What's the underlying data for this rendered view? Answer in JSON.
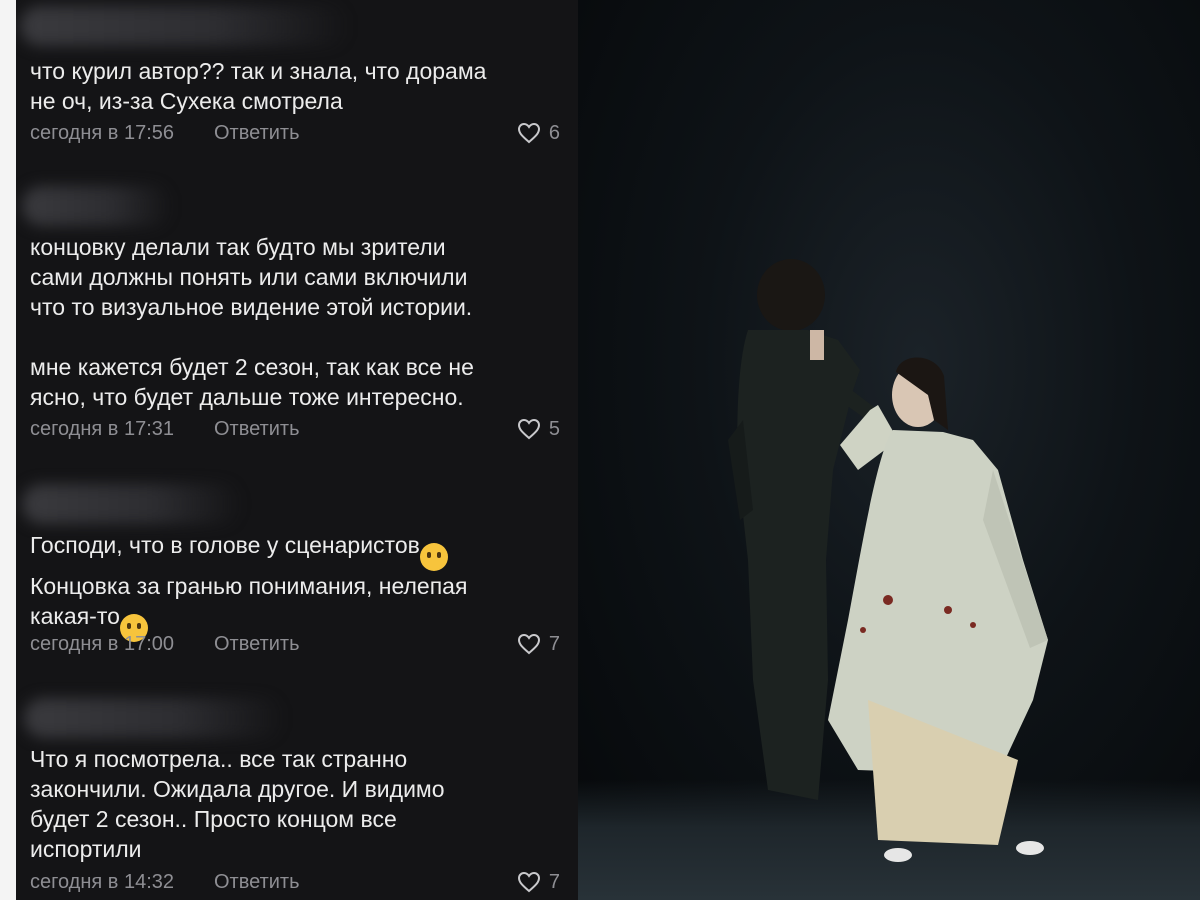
{
  "comments": [
    {
      "text": "что курил автор?? так и знала, что дорама\nне оч, из-за Сухека смотрела",
      "emoji": "",
      "time": "сегодня в 17:56",
      "reply": "Ответить",
      "likes": "6"
    },
    {
      "text": "концовку делали так будто мы зрители\nсами должны понять или сами включили\nчто то визуальное видение этой истории.\n\nмне кажется будет 2 сезон, так как все не\nясно, что будет дальше тоже интересно.",
      "emoji": "",
      "time": "сегодня в 17:31",
      "reply": "Ответить",
      "likes": "5"
    },
    {
      "text_line1": "Господи, что в голове у сценаристов",
      "emoji1": "🤔",
      "text_line2": "Концовка за гранью понимания, нелепая",
      "text_line3": "какая-то",
      "emoji2": "🙄",
      "time": "сегодня в 17:00",
      "reply": "Ответить",
      "likes": "7"
    },
    {
      "text": "Что я посмотрела.. все так странно\nзакончили. Ожидала другое. И видимо\nбудет 2 сезон.. Просто концом все\nиспортили",
      "emoji": "",
      "time": "сегодня в 14:32",
      "reply": "Ответить",
      "likes": "7"
    }
  ],
  "icons": {
    "like": "heart-outline-icon"
  },
  "colors": {
    "panel_bg": "#141416",
    "text": "#ececec",
    "meta": "#8e8e93"
  }
}
